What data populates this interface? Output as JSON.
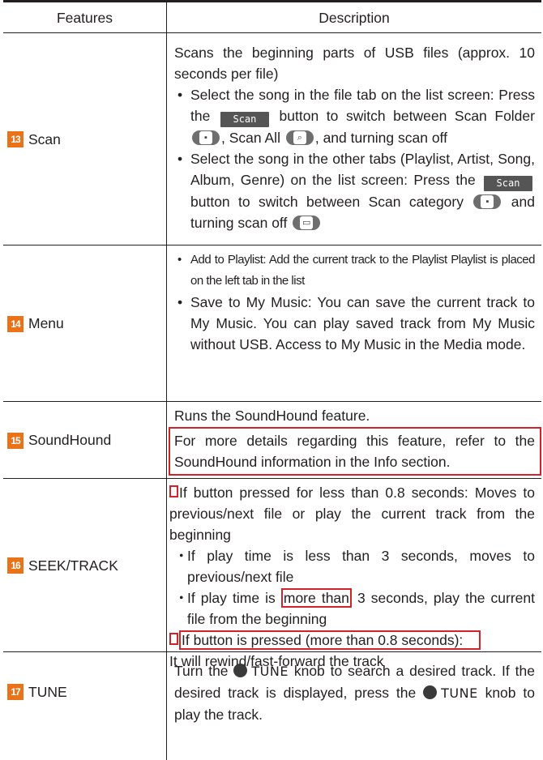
{
  "header": {
    "features": "Features",
    "description": "Description"
  },
  "rows": [
    {
      "num": "13",
      "feature": "Scan",
      "lines": [
        "Scans the beginning parts of USB files (approx. 10 seconds per file)",
        "Select the song in the file tab on the list screen: Press the",
        "button to switch between Scan Folder",
        ", Scan All",
        ", and turning scan off",
        "Select the song in the other tabs (Playlist, Artist, Song, Album, Genre) on the list screen: Press the",
        "button to switch between Scan category",
        "and turning scan off"
      ],
      "scan_button_label": "Scan",
      "icons": [
        "scan-folder-icon",
        "scan-all-icon",
        "scan-category-icon",
        "scan-off-icon"
      ]
    },
    {
      "num": "14",
      "feature": "Menu",
      "lines": [
        "Add to Playlist: Add the current track to the Playlist Playlist is placed on the left tab in the list",
        "Save to My Music: You can save the current track to My Music. You can play saved track from My Music without USB. Access to My Music in the Media mode."
      ]
    },
    {
      "num": "15",
      "feature": "SoundHound",
      "lines": [
        "Runs the SoundHound feature.",
        "For more details regarding this feature, refer to the SoundHound information in the Info section."
      ]
    },
    {
      "num": "16",
      "feature": "SEEK/TRACK",
      "lines": [
        "If button pressed for less than 0.8 seconds: Moves to previous/next file or play the current track from the beginning",
        "If play time is less than 3 seconds, moves to previous/next file",
        "If play time is",
        "more than",
        "3 seconds, play the current file from the beginning",
        "If button is pressed (more than 0.8 seconds):",
        "It will rewind/fast-forward the track"
      ]
    },
    {
      "num": "17",
      "feature": "TUNE",
      "lines": [
        "Turn the",
        "TUNE",
        "knob to search a desired track. If the desired track is displayed, press the",
        "knob to play the track."
      ]
    }
  ],
  "bullet": "•",
  "bullet_small": "・"
}
